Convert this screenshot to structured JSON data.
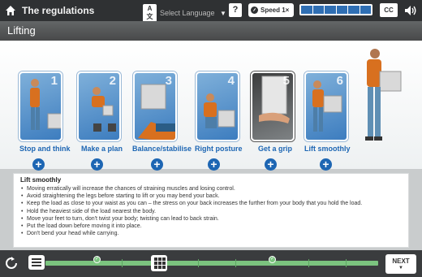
{
  "header": {
    "title": "The regulations",
    "language_badge": "A文",
    "language_placeholder": "Select Language",
    "help_label": "?",
    "speed_label": "Speed 1×",
    "progress_segments": 6,
    "cc_label": "CC"
  },
  "section": {
    "title": "Lifting"
  },
  "steps": [
    {
      "number": "1",
      "label": "Stop and think"
    },
    {
      "number": "2",
      "label": "Make a plan"
    },
    {
      "number": "3",
      "label": "Balance/stabilise"
    },
    {
      "number": "4",
      "label": "Right posture"
    },
    {
      "number": "5",
      "label": "Get a grip"
    },
    {
      "number": "6",
      "label": "Lift smoothly"
    }
  ],
  "info": {
    "heading": "Lift smoothly",
    "bullets": [
      "Moving erratically will increase the chances of straining muscles and losing control.",
      "Avoid straightening the legs before starting to lift or you may bend your back.",
      "Keep the load as close to your waist as you can – the stress on your back increases the further from your body that you hold the load.",
      "Hold the heaviest side of the load nearest the body.",
      "Move your feet to turn, don't twist your body; twisting can lead to back strain.",
      "Put the load down before moving it into place.",
      "Don't bend your head while carrying."
    ]
  },
  "footer": {
    "next_label": "NEXT",
    "checkmark": "✓"
  },
  "colors": {
    "accent_blue": "#1d66b3",
    "progress_green": "#7bc47f",
    "topbar": "#2f3133"
  }
}
